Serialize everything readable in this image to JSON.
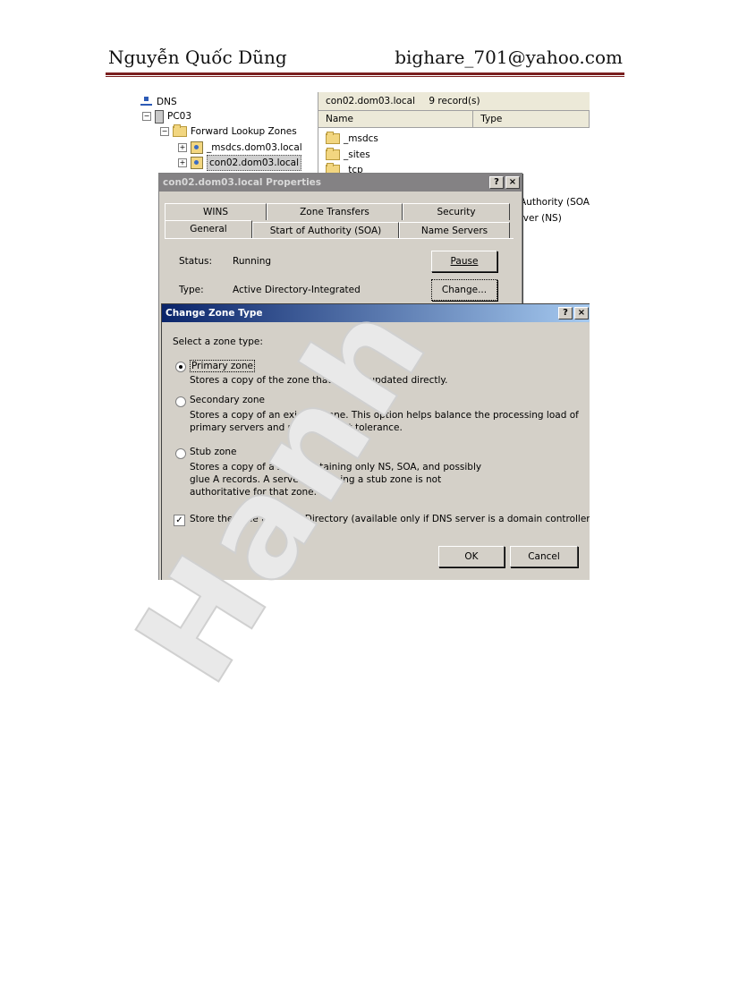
{
  "header": {
    "author": "Nguyễn Quốc Dũng",
    "email": "bighare_701@yahoo.com"
  },
  "watermark": "Hanh",
  "mmc": {
    "tree": {
      "root": "DNS",
      "server": "PC03",
      "forward_zones": "Forward Lookup Zones",
      "zone1": "_msdcs.dom03.local",
      "zone2": "con02.dom03.local"
    },
    "list": {
      "title": "con02.dom03.local",
      "count": "9 record(s)",
      "columns": [
        "Name",
        "Type"
      ],
      "rows": [
        "_msdcs",
        "_sites",
        "_tcp"
      ],
      "right_snippets": [
        "f Authority (SOA",
        "erver (NS)",
        "}",
        "}",
        "}"
      ]
    }
  },
  "properties": {
    "title": "con02.dom03.local Properties",
    "help": "?",
    "close": "×",
    "tabs_back": [
      "WINS",
      "Zone Transfers",
      "Security"
    ],
    "tabs_front": [
      "General",
      "Start of Authority (SOA)",
      "Name Servers"
    ],
    "status_label": "Status:",
    "status_value": "Running",
    "type_label": "Type:",
    "type_value": "Active Directory-Integrated",
    "pause_button": "Pause",
    "change_button": "Change..."
  },
  "change_zone": {
    "title": "Change Zone Type",
    "help": "?",
    "close": "×",
    "prompt": "Select a zone type:",
    "options": [
      {
        "label": "Primary zone",
        "selected": true,
        "desc": [
          "Stores a copy of the zone that can be updated directly."
        ]
      },
      {
        "label": "Secondary zone",
        "selected": false,
        "desc": [
          "Stores a copy of an existing zone. This option helps balance the processing load of",
          "primary servers and provides fault tolerance."
        ]
      },
      {
        "label": "Stub zone",
        "selected": false,
        "desc": [
          "Stores a copy of a zone containing only NS, SOA, and possibly",
          "glue A records. A server containing a stub zone is not",
          "authoritative for that zone."
        ]
      }
    ],
    "ad_checkbox": {
      "label": "Store the zone in Active Directory (available only if DNS server is a domain controller)",
      "checked": true,
      "mark": "✓"
    },
    "ok_button": "OK",
    "cancel_button": "Cancel"
  }
}
